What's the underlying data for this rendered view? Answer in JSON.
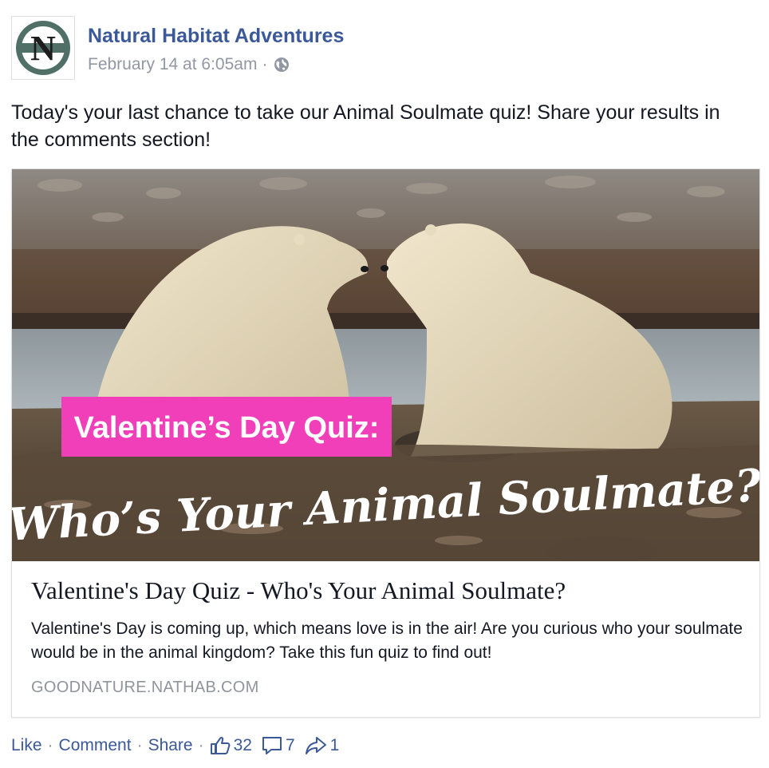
{
  "post": {
    "page_name": "Natural Habitat Adventures",
    "timestamp": "February 14 at 6:05am",
    "meta_separator": "·",
    "privacy_icon": "globe-icon",
    "avatar_letter": "N",
    "text": "Today's your last chance to take our Animal Soulmate quiz! Share your results in the comments section!"
  },
  "link_card": {
    "image": {
      "banner_text": "Valentine’s Day Quiz:",
      "script_text": "Who’s Your Animal Soulmate?"
    },
    "title": "Valentine's Day Quiz - Who's Your Animal Soulmate?",
    "description": "Valentine's Day is coming up, which means love is in the air! Are you curious who your soulmate would be in the animal kingdom? Take this fun quiz to find out!",
    "domain": "GOODNATURE.NATHAB.COM"
  },
  "actions": {
    "like_label": "Like",
    "comment_label": "Comment",
    "share_label": "Share",
    "separator": "·",
    "like_count": "32",
    "comment_count": "7",
    "share_count": "1"
  },
  "colors": {
    "link_blue": "#3b5998",
    "meta_gray": "#9197a3",
    "banner_pink": "#f03fb8",
    "avatar_green": "#4f6f67"
  }
}
